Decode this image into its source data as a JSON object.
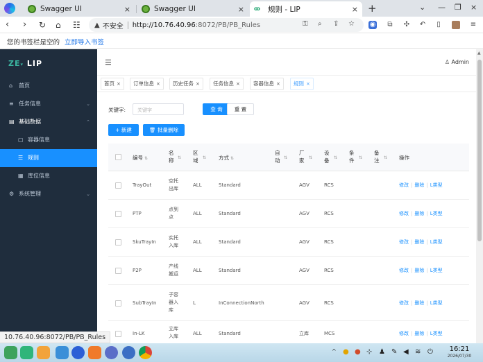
{
  "browser": {
    "tabs": [
      {
        "title": "Swagger UI",
        "active": false
      },
      {
        "title": "Swagger UI",
        "active": false
      },
      {
        "title": "规则 - LIP",
        "active": true
      }
    ],
    "new_tab": "+",
    "close_glyph": "×",
    "security_label": "不安全",
    "url_host": "http://10.76.40.96",
    "url_path": ":8072/PB/PB_Rules",
    "bookmarks_text": "您的书签栏是空的",
    "bookmarks_link": "立即导入书签",
    "status_url": "10.76.40.96:8072/PB/PB_Rules"
  },
  "app": {
    "logo_mark": "ZE",
    "logo_text": "LIP",
    "user": "Admin",
    "menu": [
      {
        "label": "首页",
        "icon": "home-icon",
        "glyph": "⌂",
        "level": 0
      },
      {
        "label": "任务信息",
        "icon": "list-icon",
        "glyph": "≡",
        "level": 0,
        "arrow": "⌄"
      },
      {
        "label": "基础数据",
        "icon": "document-icon",
        "glyph": "▤",
        "level": 0,
        "arrow": "⌃",
        "open": true
      },
      {
        "label": "容器信息",
        "icon": "box-icon",
        "glyph": "▢",
        "level": 1
      },
      {
        "label": "规则",
        "icon": "rules-icon",
        "glyph": "☰",
        "level": 1,
        "active": true
      },
      {
        "label": "库位信息",
        "icon": "grid-icon",
        "glyph": "▦",
        "level": 1
      },
      {
        "label": "系统管理",
        "icon": "gear-icon",
        "glyph": "⚙",
        "level": 0,
        "arrow": "⌄"
      }
    ],
    "tags": [
      {
        "label": "首页"
      },
      {
        "label": "订单信息"
      },
      {
        "label": "历史任务"
      },
      {
        "label": "任务信息"
      },
      {
        "label": "容器信息"
      },
      {
        "label": "规则",
        "active": true
      }
    ]
  },
  "search": {
    "keyword_label": "关键字:",
    "keyword_placeholder": "关键字",
    "query_button": "查 询",
    "reset_button": "重 置",
    "add_button": "+ 新建",
    "batch_delete_button": "批量删除"
  },
  "table": {
    "columns": [
      "编号",
      "名称",
      "区域",
      "方式",
      "自动",
      "厂家",
      "设备",
      "条件",
      "备注",
      "操作"
    ],
    "rows": [
      {
        "code": "TrayOut",
        "name": "空托出库",
        "area": "ALL",
        "mode": "Standard",
        "auto": "",
        "vendor": "AGV",
        "device": "RCS",
        "condition": "",
        "remark": ""
      },
      {
        "code": "PTP",
        "name": "点到点",
        "area": "ALL",
        "mode": "Standard",
        "auto": "",
        "vendor": "AGV",
        "device": "RCS",
        "condition": "",
        "remark": ""
      },
      {
        "code": "SkuTrayIn",
        "name": "实托入库",
        "area": "ALL",
        "mode": "Standard",
        "auto": "",
        "vendor": "AGV",
        "device": "RCS",
        "condition": "",
        "remark": ""
      },
      {
        "code": "P2P",
        "name": "产线搬运",
        "area": "ALL",
        "mode": "Standard",
        "auto": "",
        "vendor": "AGV",
        "device": "RCS",
        "condition": "",
        "remark": ""
      },
      {
        "code": "SubTrayIn",
        "name": "子容器入库",
        "area": "L",
        "mode": "InConnectionNorth",
        "auto": "",
        "vendor": "AGV",
        "device": "RCS",
        "condition": "",
        "remark": ""
      },
      {
        "code": "In-LK",
        "name": "立库入库",
        "area": "ALL",
        "mode": "Standard",
        "auto": "",
        "vendor": "立库",
        "device": "MCS",
        "condition": "",
        "remark": ""
      }
    ],
    "actions": {
      "edit": "修改",
      "delete": "删除",
      "ltype": "L类型"
    }
  },
  "taskbar": {
    "time": "16:21",
    "date": "2026/07/30"
  }
}
